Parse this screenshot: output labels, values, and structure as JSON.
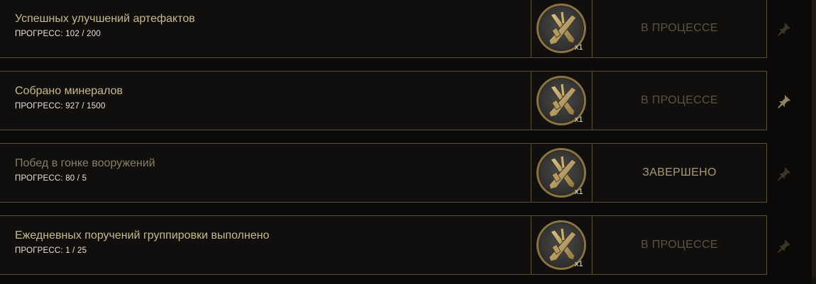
{
  "tasks": [
    {
      "title": "Успешных улучшений артефактов",
      "progress_label": "ПРОГРЕСС: 102 / 200",
      "reward": {
        "icon": "crossed-wrenches-medal-icon",
        "qty": "x1"
      },
      "status": "В ПРОЦЕССЕ",
      "state": "in-progress",
      "pinned": false
    },
    {
      "title": "Собрано минералов",
      "progress_label": "ПРОГРЕСС: 927 / 1500",
      "reward": {
        "icon": "crossed-wrenches-medal-icon",
        "qty": "x1"
      },
      "status": "В ПРОЦЕССЕ",
      "state": "in-progress",
      "pinned": true
    },
    {
      "title": "Побед в гонке вооружений",
      "progress_label": "ПРОГРЕСС: 80 / 5",
      "reward": {
        "icon": "crossed-wrenches-medal-icon",
        "qty": "x1"
      },
      "status": "ЗАВЕРШЕНО",
      "state": "completed",
      "pinned": false
    },
    {
      "title": "Ежедневных поручений группировки выполнено",
      "progress_label": "ПРОГРЕСС: 1 / 25",
      "reward": {
        "icon": "crossed-wrenches-medal-icon",
        "qty": "x1"
      },
      "status": "В ПРОЦЕССЕ",
      "state": "in-progress",
      "pinned": false
    }
  ],
  "colors": {
    "background": "#0b0a09",
    "row_background": "#100f0d",
    "border": "#5a5035",
    "title": "#c9b98f",
    "title_completed": "#8a7f64",
    "status_in_progress": "#5a5440",
    "status_completed": "#a59a7b",
    "pin_active": "#8e8463",
    "pin_inactive": "#3a3729"
  }
}
